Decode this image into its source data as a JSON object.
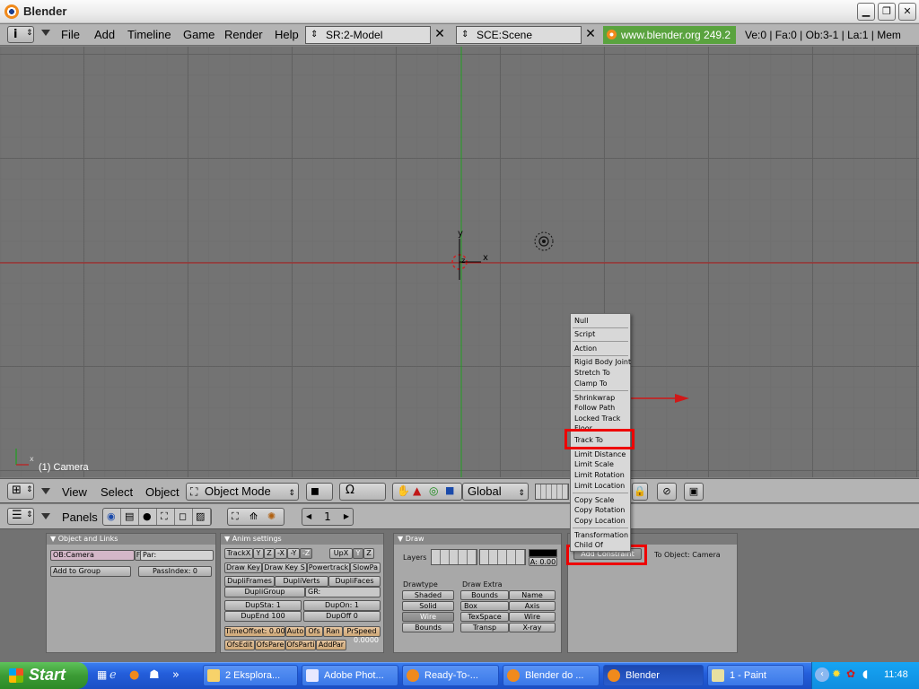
{
  "window": {
    "title": "Blender"
  },
  "info_header": {
    "menus": [
      "File",
      "Add",
      "Timeline",
      "Game",
      "Render",
      "Help"
    ],
    "screen": "SR:2-Model",
    "scene": "SCE:Scene",
    "url": "www.blender.org 249.2",
    "stats": "Ve:0 | Fa:0 | Ob:3-1 | La:1 | Mem"
  },
  "viewport": {
    "object_label": "(1) Camera",
    "axis_y": "y",
    "axis_x": "x",
    "axis_z": "z",
    "corner_x": "x"
  },
  "view_header": {
    "menus": [
      "View",
      "Select",
      "Object"
    ],
    "mode": "Object Mode",
    "orientation": "Global"
  },
  "buttons_header": {
    "panels_label": "Panels",
    "frame": "1"
  },
  "panels": {
    "object_links": {
      "title": "Object and Links",
      "ob_field": "OB:Camera",
      "f_btn": "F",
      "par_field": "Par:",
      "add_group": "Add to Group",
      "pass_index": "PassIndex: 0"
    },
    "anim": {
      "title": "Anim settings",
      "track": [
        "TrackX",
        "Y",
        "Z",
        "-X",
        "-Y",
        "-Z"
      ],
      "up": [
        "UpX",
        "Y",
        "Z"
      ],
      "row2": [
        "Draw Key",
        "Draw Key S",
        "Powertrack",
        "SlowPa"
      ],
      "row3": [
        "DupliFrames",
        "DupliVerts",
        "DupliFaces"
      ],
      "dupligroup": "DupliGroup",
      "gr": "GR:",
      "dup_sta": "DupSta: 1",
      "dup_on": "DupOn: 1",
      "dup_end": "DupEnd 100",
      "dup_off": "DupOff 0",
      "time_offset": "TimeOffset: 0.00",
      "row_time": [
        "Auto",
        "Ofs",
        "Ran",
        "PrSpeed"
      ],
      "row_last": [
        "OfsEdit",
        "OfsPare",
        "OfsParti",
        "AddPar"
      ],
      "small_value": "0.0000"
    },
    "draw": {
      "title": "Draw",
      "layers": "Layers",
      "alpha": "A: 0.00",
      "drawtype_label": "Drawtype",
      "drawtype": [
        "Shaded",
        "Solid",
        "Wire",
        "Bounds"
      ],
      "draw_extra_label": "Draw Extra",
      "extra_left": [
        "Bounds",
        "Box",
        "TexSpace",
        "Transp"
      ],
      "extra_right": [
        "Name",
        "Axis",
        "Wire",
        "X-ray"
      ]
    },
    "constraints": {
      "add_constraint": "Add Constraint",
      "to_object": "To Object: Camera"
    }
  },
  "popup_menu": {
    "items": [
      "Null",
      "Script",
      "Action",
      "Rigid Body Joint",
      "Stretch To",
      "Clamp To",
      "Shrinkwrap",
      "Follow Path",
      "Locked Track",
      "Floor",
      "Track To",
      "Limit Distance",
      "Limit Scale",
      "Limit Rotation",
      "Limit Location",
      "Copy Scale",
      "Copy Rotation",
      "Copy Location",
      "Transformation",
      "Child Of"
    ],
    "highlighted": "Track To"
  },
  "taskbar": {
    "start": "Start",
    "tasks": [
      "2 Eksplora...",
      "Adobe Phot...",
      "Ready-To-...",
      "Blender do ...",
      "Blender",
      "1 - Paint"
    ],
    "active": "Blender",
    "clock": "11:48"
  },
  "colors": {
    "viewport_bg": "#737373",
    "x_axis": "#c21a1a",
    "y_axis": "#1fa11f",
    "highlight_box": "#ee0000",
    "taskbar": "#245edb"
  }
}
